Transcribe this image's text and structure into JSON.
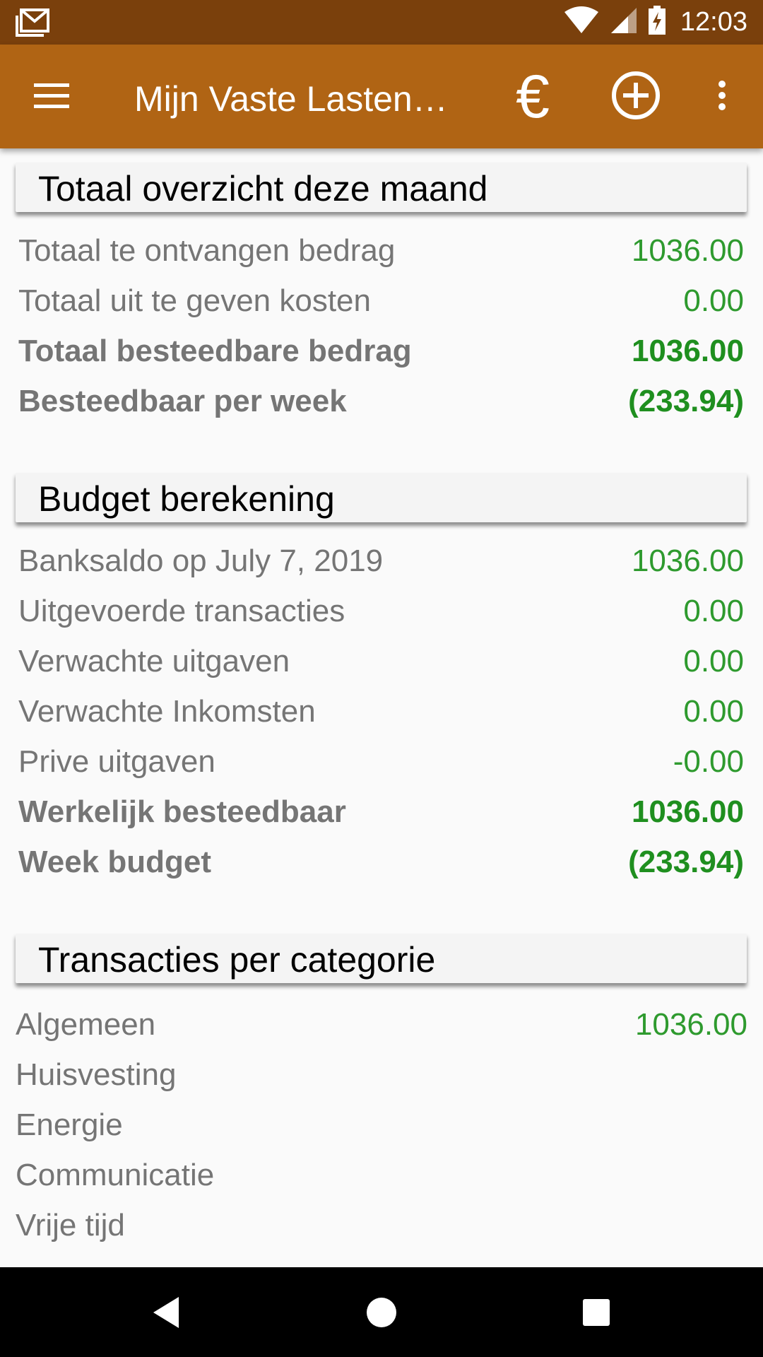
{
  "status_bar": {
    "time": "12:03",
    "icons": [
      "gmail-icon",
      "wifi-icon",
      "signal-icon",
      "battery-charging-icon"
    ]
  },
  "app_bar": {
    "title": "Mijn Vaste Lasten…",
    "menu_icon": "hamburger-menu-icon",
    "euro_icon": "€",
    "add_icon": "add-circle-icon",
    "more_icon": "more-vert-icon"
  },
  "sections": {
    "overview": {
      "title": "Totaal overzicht deze maand",
      "rows": [
        {
          "label": "Totaal te ontvangen bedrag",
          "value": "1036.00"
        },
        {
          "label": "Totaal uit te geven kosten",
          "value": "0.00"
        },
        {
          "label": "Totaal besteedbare bedrag",
          "value": "1036.00"
        },
        {
          "label": "Besteedbaar per week",
          "value": "(233.94)"
        }
      ]
    },
    "budget": {
      "title": "Budget berekening",
      "rows": [
        {
          "label": "Banksaldo op July 7, 2019",
          "value": "1036.00"
        },
        {
          "label": "Uitgevoerde transacties",
          "value": "0.00"
        },
        {
          "label": "Verwachte uitgaven",
          "value": "0.00"
        },
        {
          "label": "Verwachte Inkomsten",
          "value": "0.00"
        },
        {
          "label": "Prive uitgaven",
          "value": "-0.00"
        },
        {
          "label": "Werkelijk besteedbaar",
          "value": "1036.00"
        },
        {
          "label": "Week budget",
          "value": "(233.94)"
        }
      ]
    },
    "categories": {
      "title": "Transacties per categorie",
      "rows": [
        {
          "label": "Algemeen",
          "value": "1036.00"
        },
        {
          "label": "Huisvesting",
          "value": ""
        },
        {
          "label": "Energie",
          "value": ""
        },
        {
          "label": "Communicatie",
          "value": ""
        },
        {
          "label": "Vrije tijd",
          "value": ""
        }
      ]
    }
  },
  "colors": {
    "status_bar": "#7a400c",
    "app_bar": "#b06414",
    "value_green": "#2e9a2e",
    "label_gray": "#757575"
  },
  "nav_bar": {
    "icons": [
      "back-icon",
      "home-icon",
      "recents-icon"
    ]
  }
}
